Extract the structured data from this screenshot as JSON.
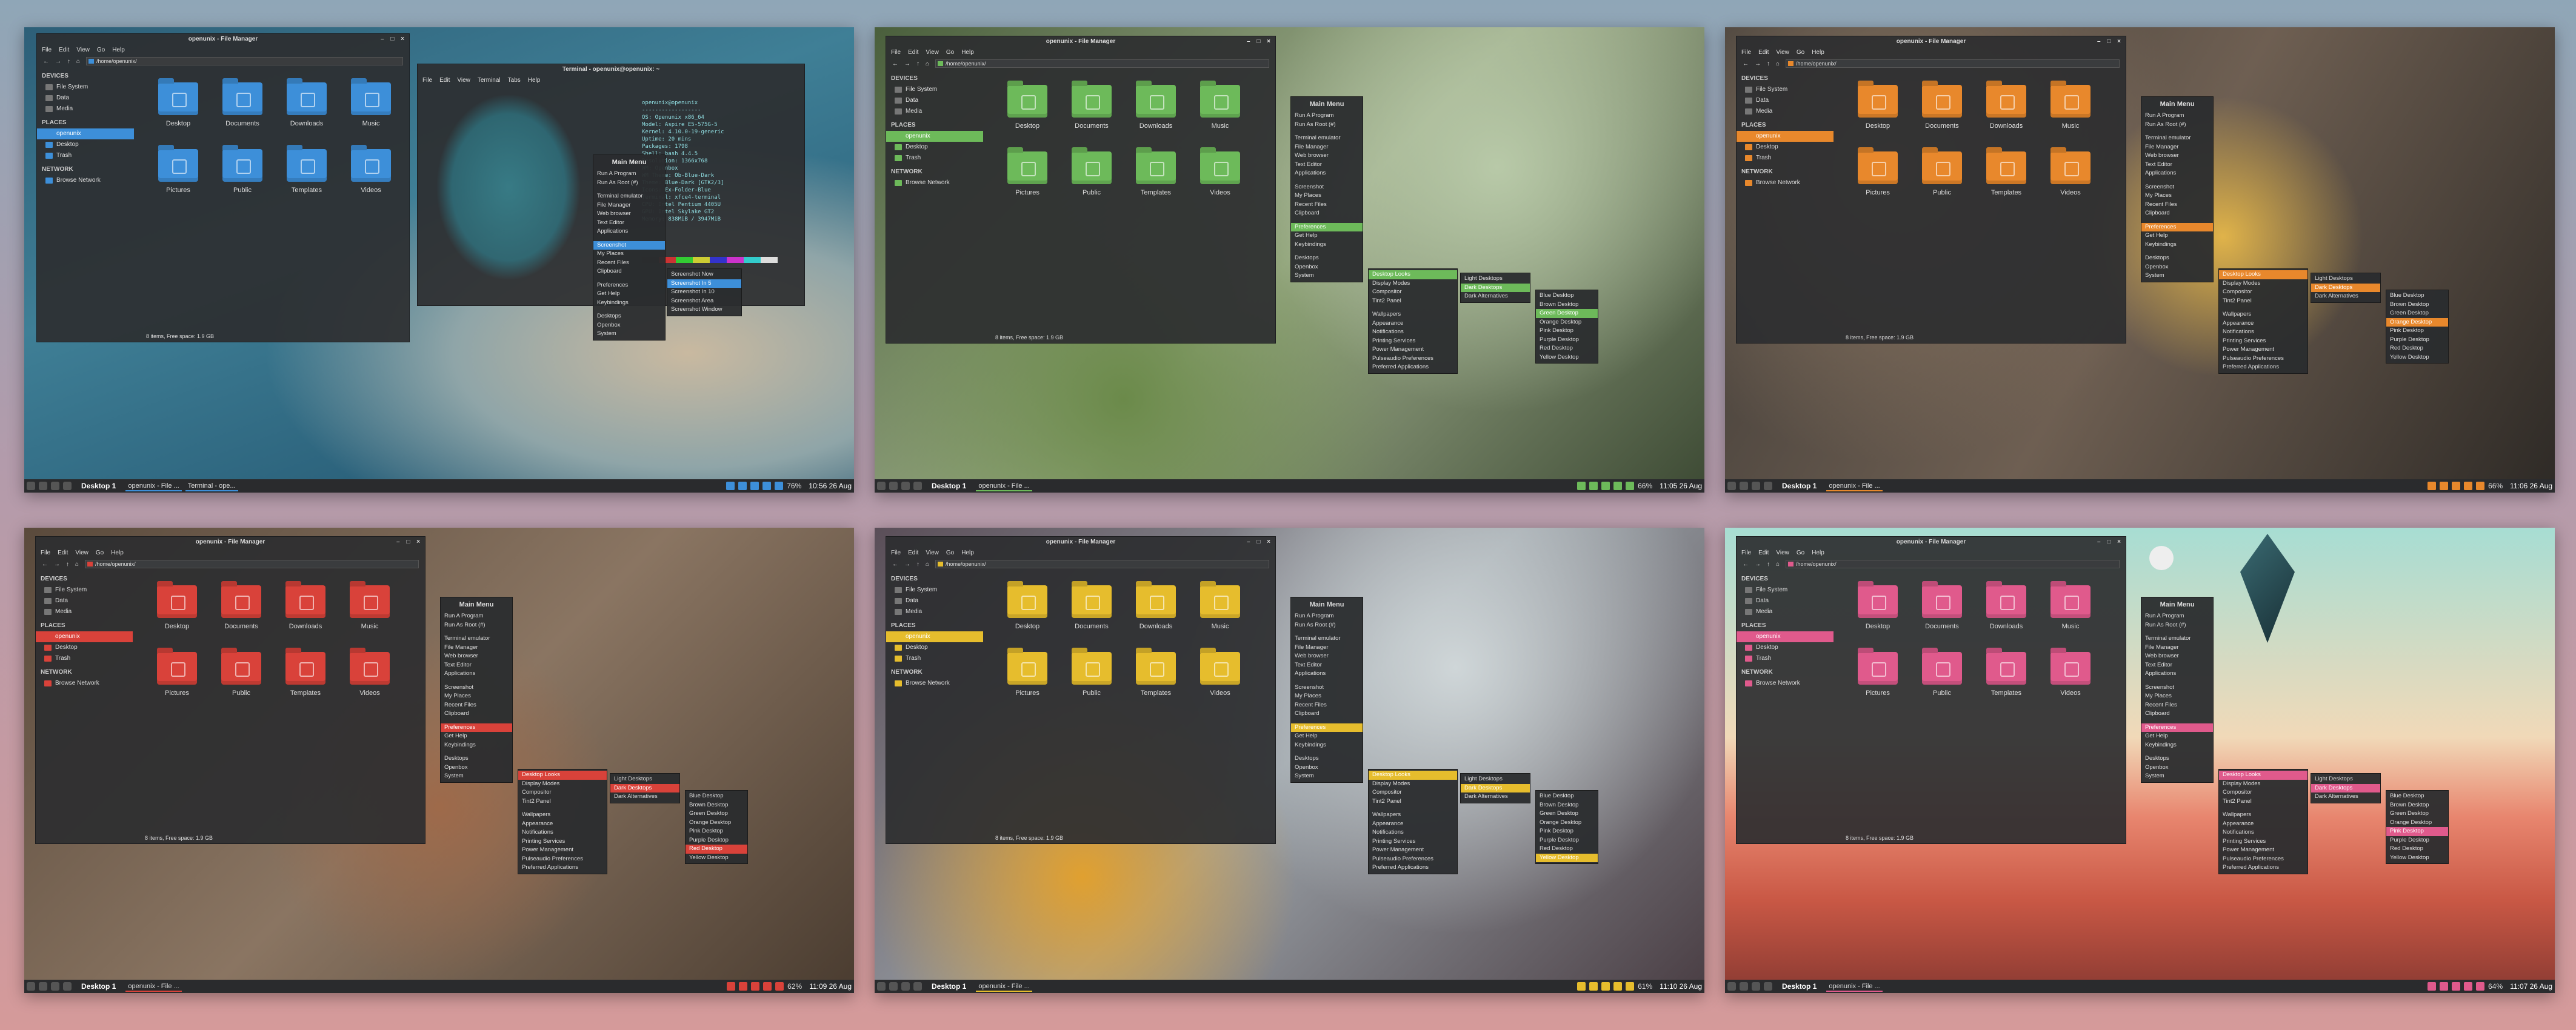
{
  "fm": {
    "title": "openunix - File Manager",
    "menus": [
      "File",
      "Edit",
      "View",
      "Go",
      "Help"
    ],
    "path": "/home/openunix/",
    "devices_h": "DEVICES",
    "devices": [
      "File System",
      "Data",
      "Media"
    ],
    "places_h": "PLACES",
    "places": [
      "openunix",
      "Desktop",
      "Trash"
    ],
    "network_h": "NETWORK",
    "network": [
      "Browse Network"
    ],
    "folders": [
      "Desktop",
      "Documents",
      "Downloads",
      "Music",
      "Pictures",
      "Public",
      "Templates",
      "Videos"
    ],
    "status": "8 items, Free space: 1.9 GB"
  },
  "menu": {
    "title": "Main Menu",
    "items": [
      "Run A Program",
      "Run As Root (#)",
      "",
      "Terminal emulator",
      "File Manager",
      "Web browser",
      "Text Editor",
      "Applications",
      "",
      "Screenshot",
      "My Places",
      "Recent Files",
      "Clipboard",
      "",
      "Preferences",
      "Get Help",
      "Keybindings",
      "",
      "Desktops",
      "Openbox",
      "System"
    ]
  },
  "prefs": [
    "Desktop Looks",
    "Display Modes",
    "Compositor",
    "Tint2 Panel",
    "",
    "Wallpapers",
    "Appearance",
    "Notifications",
    "Printing Services",
    "Power Management",
    "Pulseaudio Preferences",
    "Preferred Applications"
  ],
  "looks": [
    "Light Desktops",
    "Dark Desktops",
    "Dark Alternatives"
  ],
  "colors": [
    "Blue Desktop",
    "Brown Desktop",
    "Green Desktop",
    "Orange Desktop",
    "Pink Desktop",
    "Purple Desktop",
    "Red Desktop",
    "Yellow Desktop"
  ],
  "screenshot_sub": [
    "Screenshot Now",
    "Screenshot In 5",
    "Screenshot In 10",
    "Screenshot Area",
    "Screenshot Window"
  ],
  "terminal": {
    "title": "Terminal - openunix@openunix: ~",
    "menus": [
      "File",
      "Edit",
      "View",
      "Terminal",
      "Tabs",
      "Help"
    ],
    "info": "openunix@openunix\n------------------\nOS: Openunix x86_64\nModel: Aspire E5-575G-5\nKernel: 4.10.0-19-generic\nUptime: 20 mins\nPackages: 1798\nShell: bash 4.4.5\nResolution: 1366x768\nWM: Openbox\nWM Theme: Ob-Blue-Dark\nTheme: Blue-Dark [GTK2/3]\nIcons: Ex-Folder-Blue\nTerminal: xfce4-terminal\nCPU: Intel Pentium 4405U\nGPU: Intel Skylake GT2\nMemory: 838MiB / 3947MiB"
  },
  "desktop": "Desktop 1",
  "shots": [
    {
      "accent": "#3d8fd9",
      "task": "openunix - File ...",
      "task2": "Terminal - ope...",
      "battery": "76%",
      "clock": "10:56 26 Aug"
    },
    {
      "accent": "#6dba5a",
      "task": "openunix - File ...",
      "battery": "66%",
      "clock": "11:05 26 Aug"
    },
    {
      "accent": "#e8882c",
      "task": "openunix - File ...",
      "battery": "66%",
      "clock": "11:06 26 Aug"
    },
    {
      "accent": "#d9423a",
      "task": "openunix - File ...",
      "battery": "62%",
      "clock": "11:09 26 Aug"
    },
    {
      "accent": "#e6bd2d",
      "task": "openunix - File ...",
      "battery": "61%",
      "clock": "11:10 26 Aug"
    },
    {
      "accent": "#e05a8c",
      "task": "openunix - File ...",
      "battery": "64%",
      "clock": "11:07 26 Aug"
    }
  ]
}
